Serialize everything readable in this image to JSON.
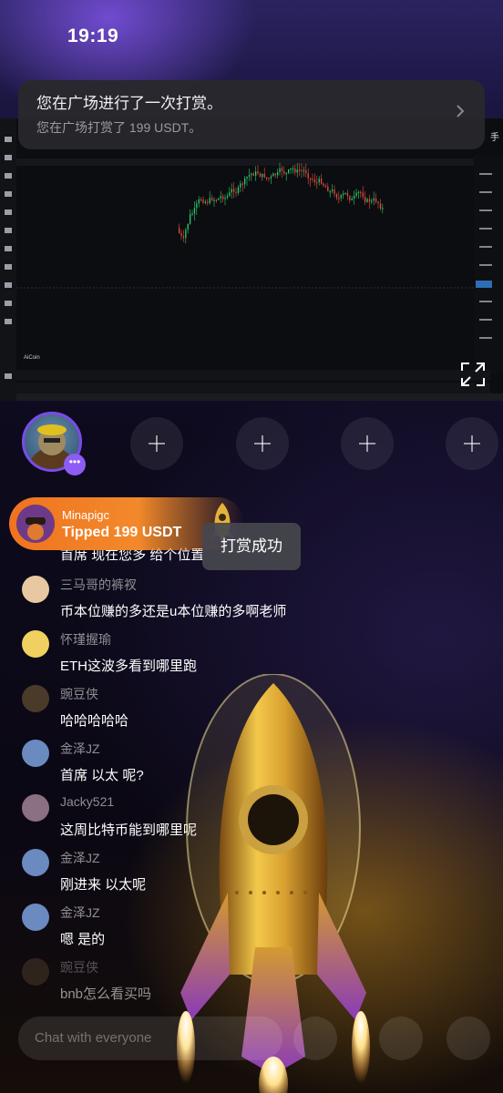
{
  "status_bar": {
    "time": "19:19"
  },
  "notification": {
    "title": "您在广场进行了一次打赏。",
    "body": "您在广场打赏了 199 USDT。"
  },
  "chart_screenshot": {
    "watermark": "AiCoin",
    "side_label": "手"
  },
  "tip_banner": {
    "user": "Minapigc",
    "text": "Tipped 199 USDT"
  },
  "toast": "打赏成功",
  "chat": [
    {
      "name": "",
      "message": "首席 现在您多 给个位置"
    },
    {
      "name": "三马哥的裤衩",
      "message": "币本位赚的多还是u本位赚的多啊老师"
    },
    {
      "name": "怀瑾握瑜",
      "message": "ETH这波多看到哪里跑"
    },
    {
      "name": "豌豆侠",
      "message": "哈哈哈哈哈"
    },
    {
      "name": "金泽JZ",
      "message": "首席 以太 呢?"
    },
    {
      "name": "Jacky521",
      "message": "这周比特币能到哪里呢"
    },
    {
      "name": "金泽JZ",
      "message": "刚进来 以太呢"
    },
    {
      "name": "金泽JZ",
      "message": "嗯 是的"
    },
    {
      "name": "豌豆侠",
      "message": "bnb怎么看买吗"
    }
  ],
  "chat_input": {
    "placeholder": "Chat with everyone"
  },
  "colors": {
    "accent": "#8d5cf5",
    "tip": "#f0731f",
    "gold": "#d9a93a"
  }
}
